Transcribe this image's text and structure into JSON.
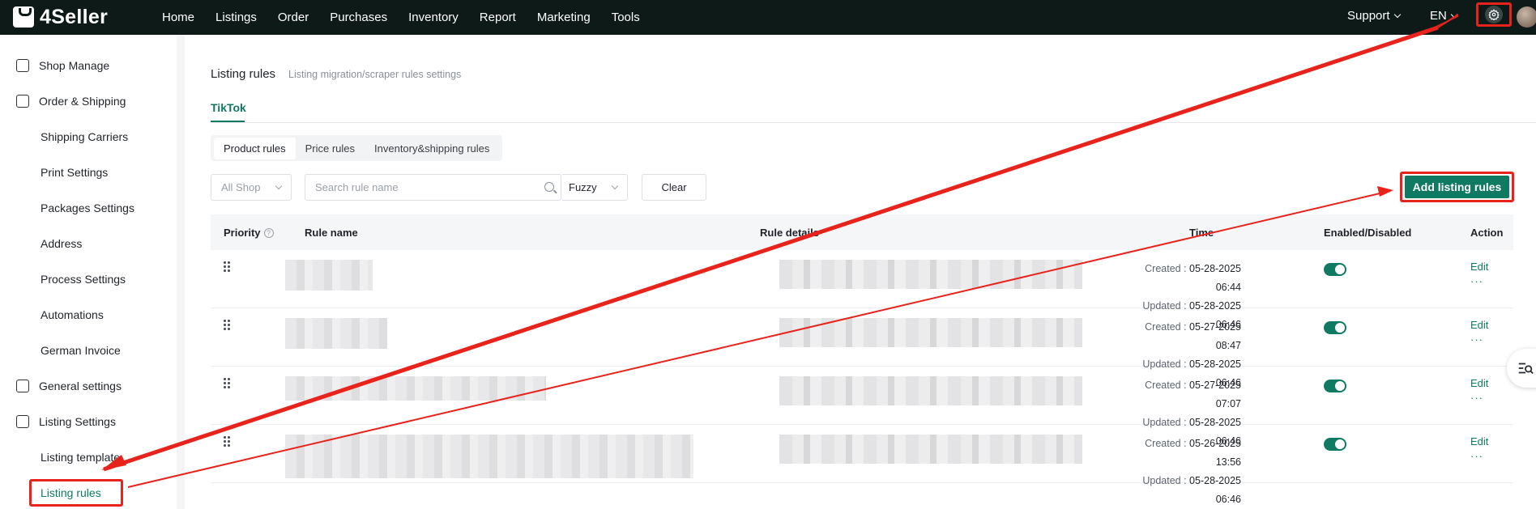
{
  "brand": {
    "name": "4Seller"
  },
  "top_nav": {
    "items": [
      "Home",
      "Listings",
      "Order",
      "Purchases",
      "Inventory",
      "Report",
      "Marketing",
      "Tools"
    ],
    "support": "Support",
    "language": "EN"
  },
  "sidebar": {
    "items": [
      {
        "label": "Shop Manage",
        "type": "group",
        "icon": "shop-icon"
      },
      {
        "label": "Order & Shipping",
        "type": "group",
        "icon": "order-bag-icon"
      },
      {
        "label": "Shipping Carriers",
        "type": "sub"
      },
      {
        "label": "Print Settings",
        "type": "sub"
      },
      {
        "label": "Packages Settings",
        "type": "sub"
      },
      {
        "label": "Address",
        "type": "sub"
      },
      {
        "label": "Process Settings",
        "type": "sub"
      },
      {
        "label": "Automations",
        "type": "sub"
      },
      {
        "label": "German Invoice",
        "type": "sub"
      },
      {
        "label": "General settings",
        "type": "group",
        "icon": "general-settings-icon"
      },
      {
        "label": "Listing Settings",
        "type": "group",
        "icon": "listing-settings-icon"
      },
      {
        "label": "Listing template",
        "type": "sub"
      },
      {
        "label": "Listing rules",
        "type": "sub",
        "active": true
      }
    ]
  },
  "page": {
    "title": "Listing rules",
    "subtitle": "Listing migration/scraper rules settings",
    "platform_tab": "TikTok"
  },
  "rule_tabs": [
    "Product rules",
    "Price rules",
    "Inventory&shipping rules"
  ],
  "filters": {
    "shop": "All Shop",
    "search_placeholder": "Search rule name",
    "match_mode": "Fuzzy",
    "clear_label": "Clear"
  },
  "add_button": "Add listing rules",
  "table": {
    "headers": [
      "Priority",
      "Rule name",
      "Rule details",
      "Time",
      "Enabled/Disabled",
      "Action"
    ],
    "rows": [
      {
        "created_label": "Created :",
        "created": "05-28-2025 06:44",
        "updated_label": "Updated :",
        "updated": "05-28-2025 06:46",
        "enabled": true,
        "edit": "Edit",
        "more": "···"
      },
      {
        "created_label": "Created :",
        "created": "05-27-2025 08:47",
        "updated_label": "Updated :",
        "updated": "05-28-2025 06:46",
        "enabled": true,
        "edit": "Edit",
        "more": "···"
      },
      {
        "created_label": "Created :",
        "created": "05-27-2025 07:07",
        "updated_label": "Updated :",
        "updated": "05-28-2025 06:46",
        "enabled": true,
        "edit": "Edit",
        "more": "···"
      },
      {
        "created_label": "Created :",
        "created": "05-26-2025 13:56",
        "updated_label": "Updated :",
        "updated": "05-28-2025 06:46",
        "enabled": true,
        "edit": "Edit",
        "more": "···"
      }
    ]
  },
  "colors": {
    "accent": "#0f7a61",
    "topbar": "#0d1a17",
    "annotation": "#e8231b"
  }
}
